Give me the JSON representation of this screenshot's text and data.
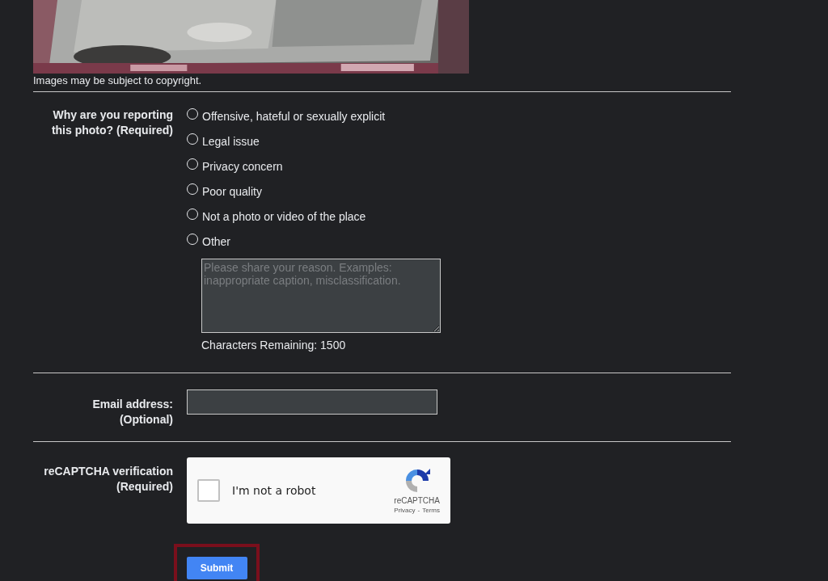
{
  "caption": "Images may be subject to copyright.",
  "reason": {
    "label": "Why are you reporting this photo? (Required)",
    "options": [
      {
        "label": "Offensive, hateful or sexually explicit",
        "selected": false
      },
      {
        "label": "Legal issue",
        "selected": false
      },
      {
        "label": "Privacy concern",
        "selected": false
      },
      {
        "label": "Poor quality",
        "selected": false
      },
      {
        "label": "Not a photo or video of the place",
        "selected": false
      },
      {
        "label": "Other",
        "selected": false
      }
    ],
    "details": {
      "placeholder": "Please share your reason. Examples: inappropriate caption, misclassification."
    },
    "counter": "Characters Remaining: 1500"
  },
  "email": {
    "label": "Email address:",
    "note": "(Optional)"
  },
  "recaptcha": {
    "label": "reCAPTCHA verification",
    "note": "(Required)",
    "checked": false,
    "text": "I'm not a robot",
    "brand": "reCAPTCHA",
    "privacy": "Privacy",
    "separator": "-",
    "terms": "Terms"
  },
  "submit": {
    "label": "Submit",
    "highlighted": true
  }
}
